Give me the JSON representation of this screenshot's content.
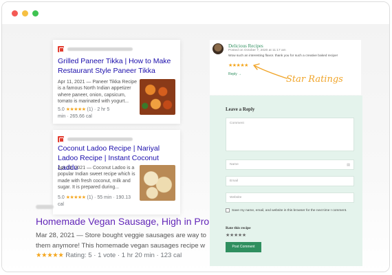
{
  "window": {
    "controls": [
      "close",
      "minimize",
      "maximize"
    ]
  },
  "cards": [
    {
      "title": "Grilled Paneer Tikka | How to Make Restaurant Style Paneer Tikka",
      "date": "Apr 11, 2021",
      "snippet": " — Paneer Tikka Recipe is a famous North Indian appetizer where paneer, onion, capsicum, tomato is marinated with yogurt...",
      "rating": "5.0",
      "stars": "★★★★★",
      "votes": "(1)",
      "time": "2 hr 5",
      "time_cont": "min",
      "calories": "265.66 cal"
    },
    {
      "title": "Coconut Ladoo Recipe | Nariyal Ladoo Recipe | Instant Coconut Laddu",
      "date": "Apr 13, 2021",
      "snippet": " — Coconut Ladoo is a popular Indian sweet recipe which is made with fresh coconut, milk and sugar. It is prepared during...",
      "rating": "5.0",
      "stars": "★★★★★",
      "votes": "(1)",
      "time": "55 min",
      "calories": "190.13",
      "calories_cont": "cal"
    }
  ],
  "big_result": {
    "title": "Homemade Vegan Sausage, High in Pro",
    "snippet_line1": "Mar 28, 2021 — Store bought veggie sausages are way to",
    "snippet_line2": "them anymore! This homemade vegan sausages recipe w",
    "stars": "★★★★★",
    "rating": "Rating: 5",
    "votes": "1 vote",
    "time": "1 hr 20 min",
    "calories": "123 cal"
  },
  "comment": {
    "author": "Delicious Recipes",
    "date": "Posted on October 7, 2020 at 11:17 am",
    "text": "Wow such an interesting flavor. thank you for such a creative baked recipe!",
    "stars": "★★★★★",
    "reply": "Reply →"
  },
  "callout": {
    "label": "Star Ratings"
  },
  "reply_form": {
    "title": "Leave a Reply",
    "comment_placeholder": "Comment",
    "name_placeholder": "Name",
    "email_placeholder": "Email",
    "website_placeholder": "Website",
    "save_label": "Save my name, email, and website in this browser for the next time I comment.",
    "rate_title": "Rate this recipe",
    "rate_stars": "★★★★★",
    "post_button": "Post Comment"
  },
  "colors": {
    "link_blue": "#1a0dab",
    "link_visited": "#6226b8",
    "star": "#f4a51c",
    "accent_green": "#2f8f5f",
    "panel_green": "#e4f3ec",
    "callout_orange": "#f0a428"
  },
  "icons": [
    "close-dot",
    "minimize-dot",
    "maximize-dot",
    "site-logo-icon",
    "user-icon",
    "arrow-icon"
  ]
}
